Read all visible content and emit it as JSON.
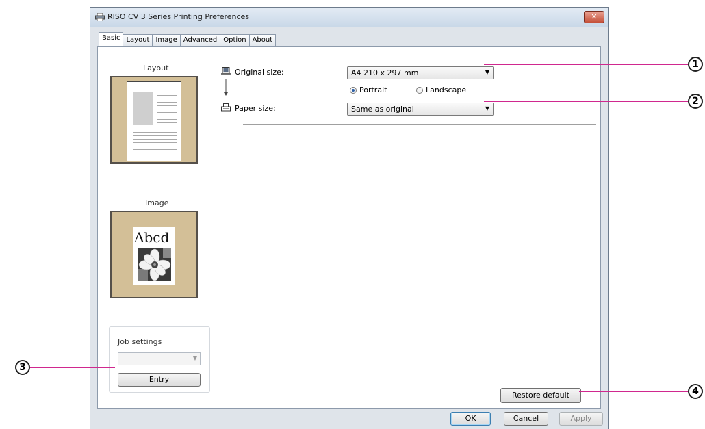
{
  "window": {
    "title": "RISO CV 3 Series Printing Preferences",
    "close_glyph": "✕"
  },
  "tabs": [
    {
      "label": "Basic",
      "active": true
    },
    {
      "label": "Layout",
      "active": false
    },
    {
      "label": "Image",
      "active": false
    },
    {
      "label": "Advanced",
      "active": false
    },
    {
      "label": "Option",
      "active": false
    },
    {
      "label": "About",
      "active": false
    }
  ],
  "preview": {
    "layout_label": "Layout",
    "image_label": "Image",
    "image_sample_text": "Abcd"
  },
  "settings": {
    "original_size_label": "Original size:",
    "original_size_value": "A4 210 x 297 mm",
    "orientation_portrait": "Portrait",
    "orientation_landscape": "Landscape",
    "orientation_selected": "Portrait",
    "paper_size_label": "Paper size:",
    "paper_size_value": "Same as original"
  },
  "job_settings": {
    "label": "Job settings",
    "combo_value": "",
    "entry_button": "Entry"
  },
  "buttons": {
    "restore_default": "Restore default",
    "ok": "OK",
    "cancel": "Cancel",
    "apply": "Apply"
  },
  "callouts": [
    "1",
    "2",
    "3",
    "4"
  ],
  "colors": {
    "callout_line": "#d0288f",
    "preview_background": "#d3bf97"
  }
}
